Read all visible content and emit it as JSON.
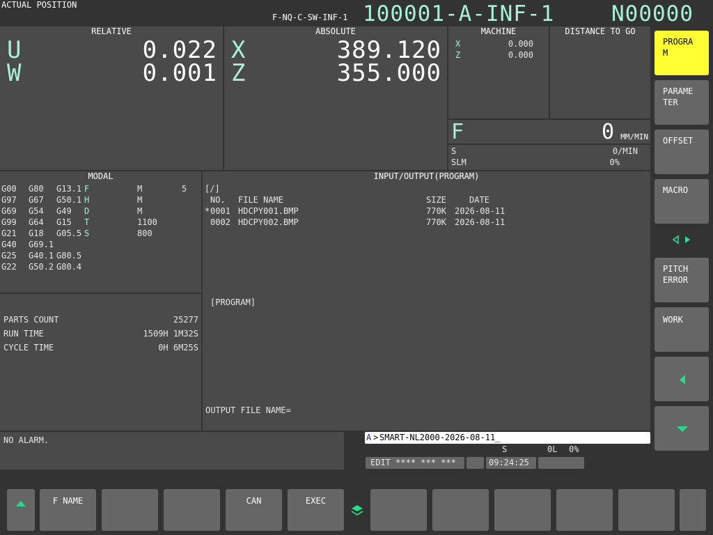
{
  "title_bar": {
    "screen_title": "ACTUAL POSITION",
    "program_file": "F-NQ-C-SW-INF-1",
    "program_name": "100001-A-INF-1",
    "sequence": "N00000"
  },
  "relative": {
    "header": "RELATIVE",
    "axes": [
      {
        "axis": "U",
        "value": "0.022"
      },
      {
        "axis": "W",
        "value": "0.001"
      }
    ]
  },
  "absolute": {
    "header": "ABSOLUTE",
    "axes": [
      {
        "axis": "X",
        "value": "389.120"
      },
      {
        "axis": "Z",
        "value": "355.000"
      }
    ]
  },
  "machine": {
    "header": "MACHINE",
    "axes": [
      {
        "axis": "X",
        "value": "0.000"
      },
      {
        "axis": "Z",
        "value": "0.000"
      }
    ]
  },
  "distance_to_go": {
    "header": "DISTANCE TO GO"
  },
  "feed": {
    "label": "F",
    "value": "0",
    "unit": "MM/MIN"
  },
  "spindle": {
    "s_label": "S",
    "s_value": "0/MIN",
    "slm_label": "SLM",
    "slm_value": "0%"
  },
  "modal": {
    "header": "MODAL",
    "rows": [
      [
        "G00",
        "G80",
        "G13.1",
        "F",
        "M",
        "5"
      ],
      [
        "G97",
        "G67",
        "G50.1",
        "H",
        "M",
        ""
      ],
      [
        "G69",
        "G54",
        "G49",
        "D",
        "M",
        ""
      ],
      [
        "G99",
        "G64",
        "G15",
        "T",
        "1100",
        ""
      ],
      [
        "G21",
        "G18",
        "G05.5",
        "S",
        "800",
        ""
      ],
      [
        "G40",
        "G69.1",
        "",
        "",
        "",
        ""
      ],
      [
        "G25",
        "G40.1",
        "G80.5",
        "",
        "",
        ""
      ],
      [
        "G22",
        "G50.2",
        "G80.4",
        "",
        "",
        ""
      ]
    ]
  },
  "counters": {
    "parts_label": "PARTS COUNT",
    "parts_value": "25277",
    "run_label": "RUN TIME",
    "run_value": "1509H 1M32S",
    "cycle_label": "CYCLE TIME",
    "cycle_value": "0H 6M25S"
  },
  "io": {
    "header": "INPUT/OUTPUT(PROGRAM)",
    "path": "[/]",
    "col_no": "NO.",
    "col_name": "FILE NAME",
    "col_size": "SIZE",
    "col_date": "DATE",
    "files": [
      {
        "marker": "*",
        "no": "0001",
        "name": "HDCPY001.BMP",
        "size": "770K",
        "date": "2026-08-11"
      },
      {
        "marker": "",
        "no": "0002",
        "name": "HDCPY002.BMP",
        "size": "770K",
        "date": "2026-08-11"
      }
    ],
    "program_label": "[PROGRAM]",
    "output_label": "OUTPUT FILE NAME="
  },
  "alarm": {
    "text": "NO ALARM."
  },
  "input_line": {
    "prefix": "A",
    "prompt": ">",
    "text": "SMART-NL2000-2026-08-11_"
  },
  "status": {
    "s_label": "S",
    "load": "0L",
    "pct": "0%",
    "mode": "EDIT **** *** ***",
    "time": "09:24:25"
  },
  "side_softkeys": [
    {
      "l1": "PROGRA",
      "l2": "M",
      "active": true
    },
    {
      "l1": "PARAME",
      "l2": "TER",
      "active": false
    },
    {
      "l1": "OFFSET",
      "l2": "",
      "active": false
    },
    {
      "l1": "MACRO",
      "l2": "",
      "active": false
    },
    {
      "l1": "PITCH",
      "l2": "ERROR",
      "active": false
    },
    {
      "l1": "WORK",
      "l2": "",
      "active": false
    }
  ],
  "bottom_softkeys": [
    {
      "label": "F NAME"
    },
    {
      "label": ""
    },
    {
      "label": ""
    },
    {
      "label": "CAN"
    },
    {
      "label": "EXEC"
    },
    {
      "label": ""
    },
    {
      "label": ""
    },
    {
      "label": ""
    },
    {
      "label": ""
    },
    {
      "label": ""
    },
    {
      "label": ""
    }
  ],
  "colors": {
    "active_key": "#ffff33",
    "accent": "#a8f0d8",
    "background": "#333333",
    "panel": "#4a4a4a"
  }
}
